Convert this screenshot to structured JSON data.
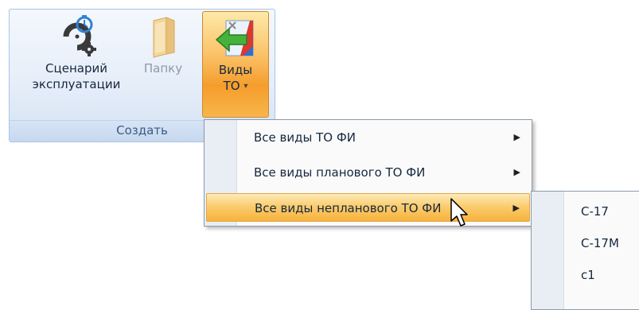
{
  "ribbon": {
    "group_caption": "Создать",
    "buttons": {
      "scenario": {
        "line1": "Сценарий",
        "line2": "эксплуатации",
        "icon": "gear-stopwatch-icon"
      },
      "folder": {
        "label": "Папку",
        "icon": "folder-icon",
        "state": "disabled"
      },
      "types": {
        "line1": "Виды",
        "line2": "ТО",
        "icon": "green-arrow-icon",
        "state": "pressed"
      }
    }
  },
  "menu": {
    "items": [
      {
        "label": "Все виды ТО ФИ",
        "has_submenu": true
      },
      {
        "label": "Все виды планового ТО ФИ",
        "has_submenu": true
      },
      {
        "label": "Все виды непланового ТО ФИ",
        "has_submenu": true,
        "highlighted": true
      }
    ]
  },
  "submenu": {
    "items": [
      {
        "label": "С-17"
      },
      {
        "label": "С-17М"
      },
      {
        "label": "с1"
      }
    ]
  },
  "colors": {
    "highlight": "#f7b23c",
    "ribbon_border": "#a9c4e6",
    "caption_text": "#3d5a86"
  }
}
